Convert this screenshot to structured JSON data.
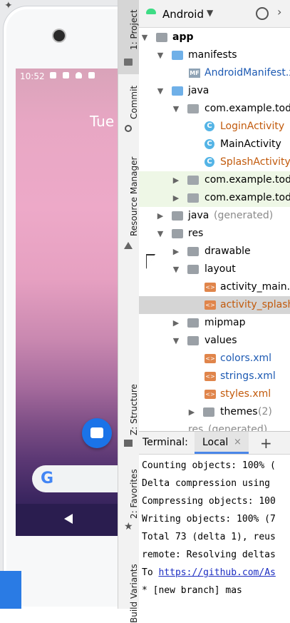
{
  "emulator": {
    "status_time": "10:52",
    "date_text": "Tue",
    "google_letter": "G"
  },
  "tool_strip": {
    "tabs": [
      {
        "label": "1: Project"
      },
      {
        "label": "Commit"
      },
      {
        "label": "Resource Manager"
      },
      {
        "label": "Z: Structure"
      },
      {
        "label": "2: Favorites"
      },
      {
        "label": "Build Variants"
      }
    ]
  },
  "project_panel": {
    "view_title": "Android",
    "view_caret": "▼",
    "tree": [
      {
        "label": "app",
        "arrow": "▼"
      },
      {
        "label": "manifests",
        "arrow": "▼"
      },
      {
        "label": "AndroidManifest.xml",
        "icon_text": "MF"
      },
      {
        "label": "java",
        "arrow": "▼"
      },
      {
        "label": "com.example.todo",
        "arrow": "▼"
      },
      {
        "label": "LoginActivity",
        "icon_text": "C"
      },
      {
        "label": "MainActivity",
        "icon_text": "C"
      },
      {
        "label": "SplashActivity",
        "icon_text": "C"
      },
      {
        "label": "com.example.todo",
        "arrow": "▶"
      },
      {
        "label": "com.example.todo",
        "arrow": "▶"
      },
      {
        "label": "java",
        "suffix": "(generated)",
        "arrow": "▶"
      },
      {
        "label": "res",
        "arrow": "▼"
      },
      {
        "label": "drawable",
        "arrow": "▶"
      },
      {
        "label": "layout",
        "arrow": "▼"
      },
      {
        "label": "activity_main.xml",
        "icon_text": "<>"
      },
      {
        "label": "activity_splash.xml",
        "icon_text": "<>"
      },
      {
        "label": "mipmap",
        "arrow": "▶"
      },
      {
        "label": "values",
        "arrow": "▼"
      },
      {
        "label": "colors.xml",
        "icon_text": "<>"
      },
      {
        "label": "strings.xml",
        "icon_text": "<>"
      },
      {
        "label": "styles.xml",
        "icon_text": "<>"
      },
      {
        "label": "themes",
        "suffix": "(2)",
        "arrow": "▶"
      },
      {
        "label": "res",
        "suffix": "(generated)"
      }
    ]
  },
  "terminal": {
    "label": "Terminal:",
    "tab_label": "Local",
    "tab_close": "×",
    "add_label": "+",
    "lines": [
      "Counting objects: 100% (",
      "Delta compression using",
      "Compressing objects: 100",
      "Writing objects: 100% (7",
      "Total 73 (delta 1), reus",
      "remote: Resolving deltas",
      "To ",
      " * [new branch]      mas"
    ],
    "link_text": "https://github.com/As"
  }
}
